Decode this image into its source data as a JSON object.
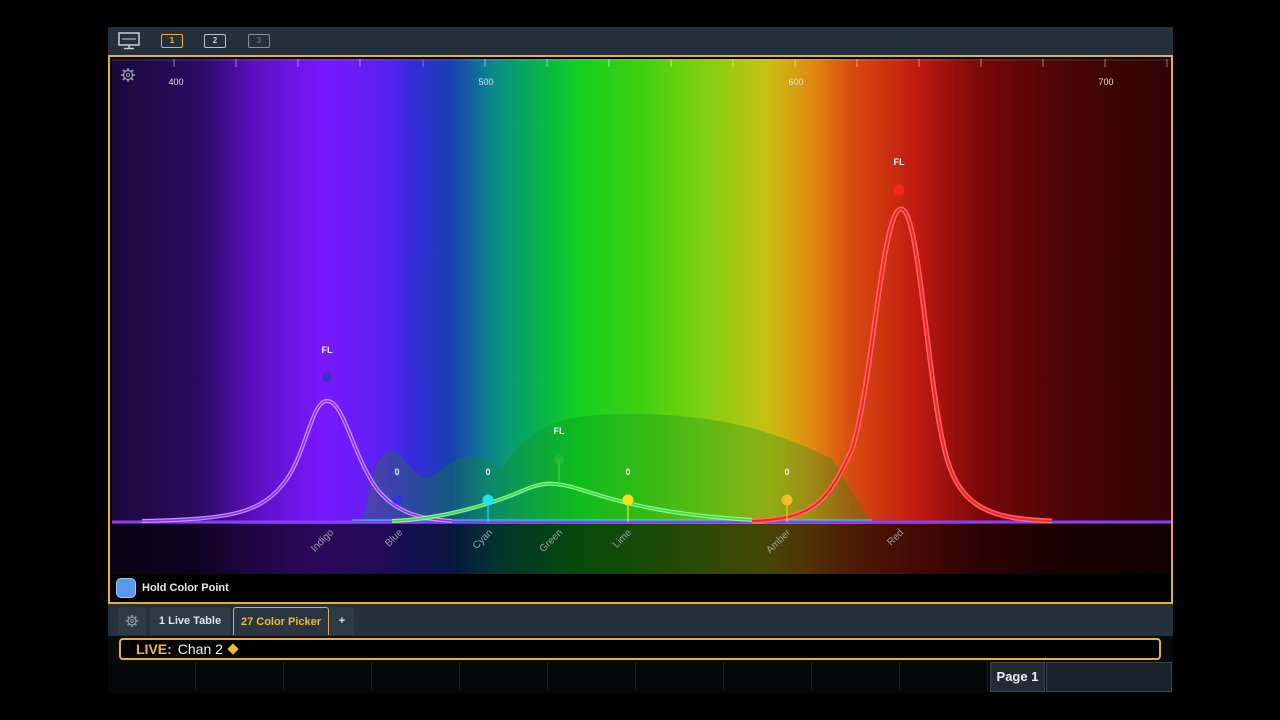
{
  "topbar": {
    "monitor_icon": "monitor-icon",
    "workspaces": [
      "1",
      "2",
      "3"
    ],
    "active_workspace": "1"
  },
  "spectrum": {
    "settings_icon": "gear-icon",
    "axis_ticks": [
      "400",
      "500",
      "600",
      "700"
    ],
    "emitters": [
      {
        "label": "Indigo",
        "level": "FL",
        "color": "#8a30ff"
      },
      {
        "label": "Blue",
        "level": "0",
        "color": "#2a2aff"
      },
      {
        "label": "Cyan",
        "level": "0",
        "color": "#20d8f0"
      },
      {
        "label": "Green",
        "level": "FL",
        "color": "#30e040"
      },
      {
        "label": "Lime",
        "level": "0",
        "color": "#e0f020"
      },
      {
        "label": "Amber",
        "level": "0",
        "color": "#f0c020"
      },
      {
        "label": "Red",
        "level": "FL",
        "color": "#ff2020"
      }
    ]
  },
  "hold": {
    "label": "Hold Color Point"
  },
  "tabs": {
    "settings_icon": "gear-icon",
    "items": [
      "1 Live Table",
      "27 Color Picker",
      "+"
    ],
    "active": "27 Color Picker"
  },
  "command_line": {
    "mode": "LIVE:",
    "text": "Chan 2"
  },
  "softkeys": {
    "page_label": "Page 1"
  },
  "colors": {
    "accent": "#e8b030",
    "chrome": "#24303c"
  }
}
